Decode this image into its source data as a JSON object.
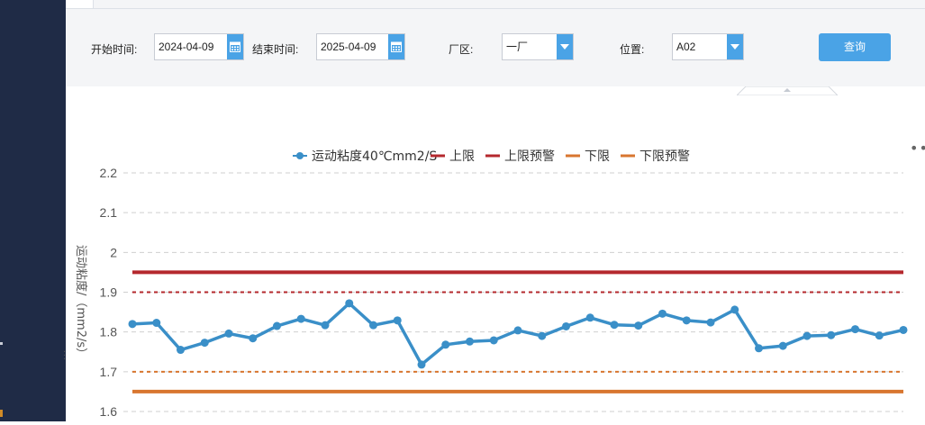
{
  "filters": {
    "start_label": "开始时间:",
    "start_value": "2024-04-09",
    "end_label": "结束时间:",
    "end_value": "2025-04-09",
    "plant_label": "厂区:",
    "plant_value": "一厂",
    "position_label": "位置:",
    "position_value": "A02",
    "query_label": "查询"
  },
  "icons": {
    "calendar": "calendar-icon",
    "dropdown": "chevron-down-icon",
    "more": "more-horizontal-icon"
  },
  "chart_data": {
    "type": "line",
    "title": "",
    "xlabel": "",
    "ylabel": "运动粘度/（mm2/s）",
    "ylim": [
      1.6,
      2.2
    ],
    "yticks": [
      "1.6",
      "1.7",
      "1.8",
      "1.9",
      "2",
      "2.1",
      "2.2"
    ],
    "grid": true,
    "legend_position": "top-center",
    "series": [
      {
        "name": "运动粘度40℃mm2/S",
        "color": "#3a8fc8",
        "values": [
          1.82,
          1.823,
          1.755,
          1.773,
          1.796,
          1.784,
          1.815,
          1.833,
          1.817,
          1.872,
          1.817,
          1.829,
          1.718,
          1.768,
          1.776,
          1.779,
          1.804,
          1.79,
          1.814,
          1.836,
          1.818,
          1.816,
          1.846,
          1.829,
          1.824,
          1.856,
          1.759,
          1.765,
          1.79,
          1.792,
          1.807,
          1.791,
          1.805
        ]
      },
      {
        "name": "上限",
        "color": "#b5282d",
        "value": 1.95,
        "style": "solid"
      },
      {
        "name": "上限预警",
        "color": "#b5282d",
        "value": 1.9,
        "style": "dashed"
      },
      {
        "name": "下限",
        "color": "#d8762f",
        "value": 1.65,
        "style": "solid"
      },
      {
        "name": "下限预警",
        "color": "#d8762f",
        "value": 1.7,
        "style": "dashed"
      }
    ]
  }
}
